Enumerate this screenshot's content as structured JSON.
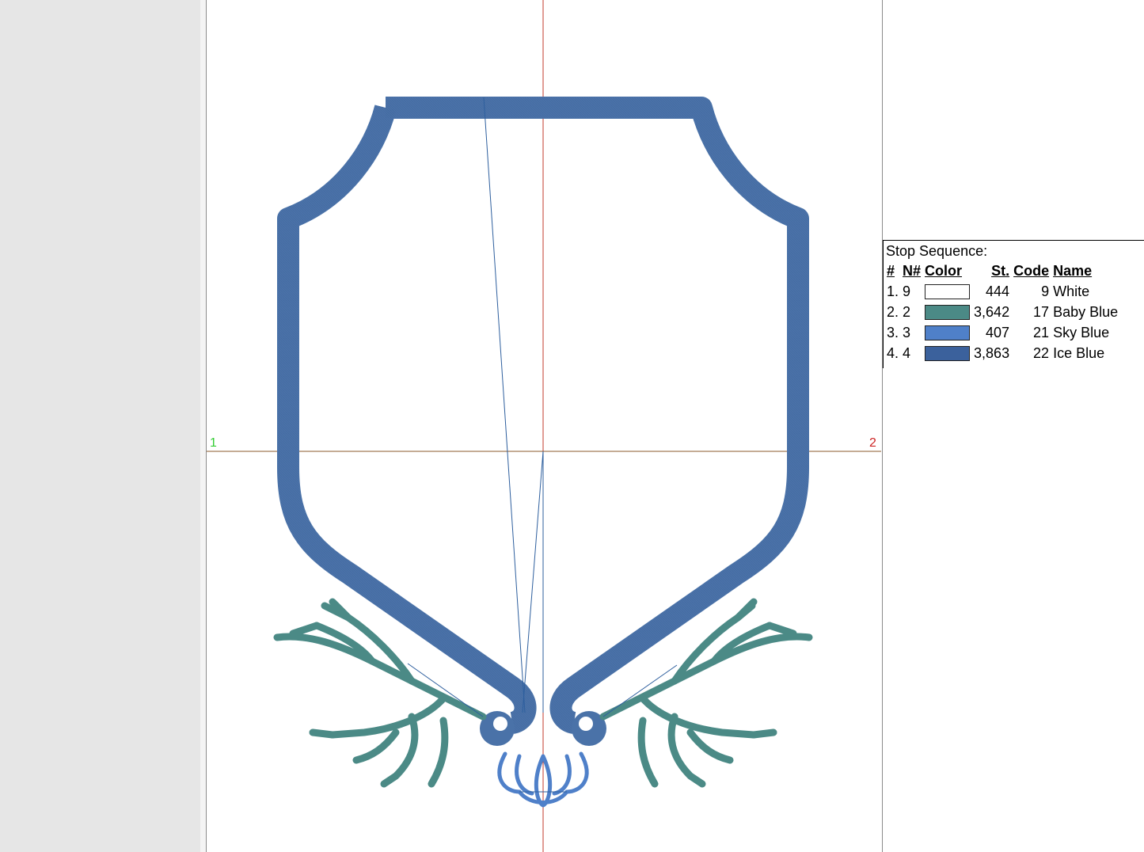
{
  "canvas": {
    "origin_marker_label": "1",
    "end_marker_label": "2",
    "colors": {
      "shield": "#4a72a8",
      "shield_light": "#5b86bd",
      "coral": "#4b8a86",
      "scroll": "#3f6aa6",
      "crosshair_v": "#c0392b",
      "crosshair_h": "#8b5a2b",
      "jump": "#2e5f9e"
    }
  },
  "stop_sequence": {
    "title": "Stop Sequence:",
    "headers": {
      "index": "#",
      "needle": "N#",
      "color": "Color",
      "stitches": "St.",
      "code": "Code",
      "name": "Name"
    },
    "rows": [
      {
        "index": "1.",
        "needle": "9",
        "swatch": "#ffffff",
        "stitches": "444",
        "code": "9",
        "name": "White"
      },
      {
        "index": "2.",
        "needle": "2",
        "swatch": "#4b8a86",
        "stitches": "3,642",
        "code": "17",
        "name": "Baby Blue"
      },
      {
        "index": "3.",
        "needle": "3",
        "swatch": "#4f80c9",
        "stitches": "407",
        "code": "21",
        "name": "Sky Blue"
      },
      {
        "index": "4.",
        "needle": "4",
        "swatch": "#3b619c",
        "stitches": "3,863",
        "code": "22",
        "name": "Ice Blue"
      }
    ]
  }
}
